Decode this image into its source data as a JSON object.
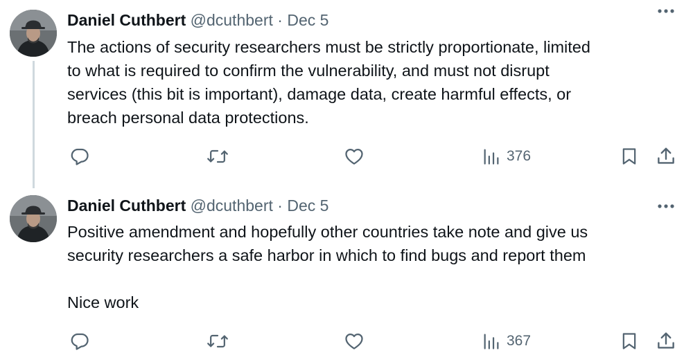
{
  "tweets": [
    {
      "author_name": "Daniel Cuthbert",
      "handle": "@dcuthbert",
      "separator": "·",
      "date": "Dec 5",
      "text": "The actions of security researchers must be strictly proportionate, limited\nto what is required to confirm the vulnerability, and must not disrupt\nservices (this bit is important), damage data, create harmful effects, or\nbreach personal data protections.",
      "views": "376"
    },
    {
      "author_name": "Daniel Cuthbert",
      "handle": "@dcuthbert",
      "separator": "·",
      "date": "Dec 5",
      "text": "Positive amendment and hopefully other countries take note and give us\nsecurity researchers a safe harbor in which to find bugs and report them\n\nNice work",
      "views": "367"
    }
  ],
  "icons": {
    "reply": "reply-icon",
    "retweet": "retweet-icon",
    "like": "like-icon",
    "views": "views-icon",
    "bookmark": "bookmark-icon",
    "share": "share-icon",
    "more": "more-icon"
  },
  "colors": {
    "text": "#0f1419",
    "secondary": "#536471",
    "thread_line": "#cfd9de"
  }
}
